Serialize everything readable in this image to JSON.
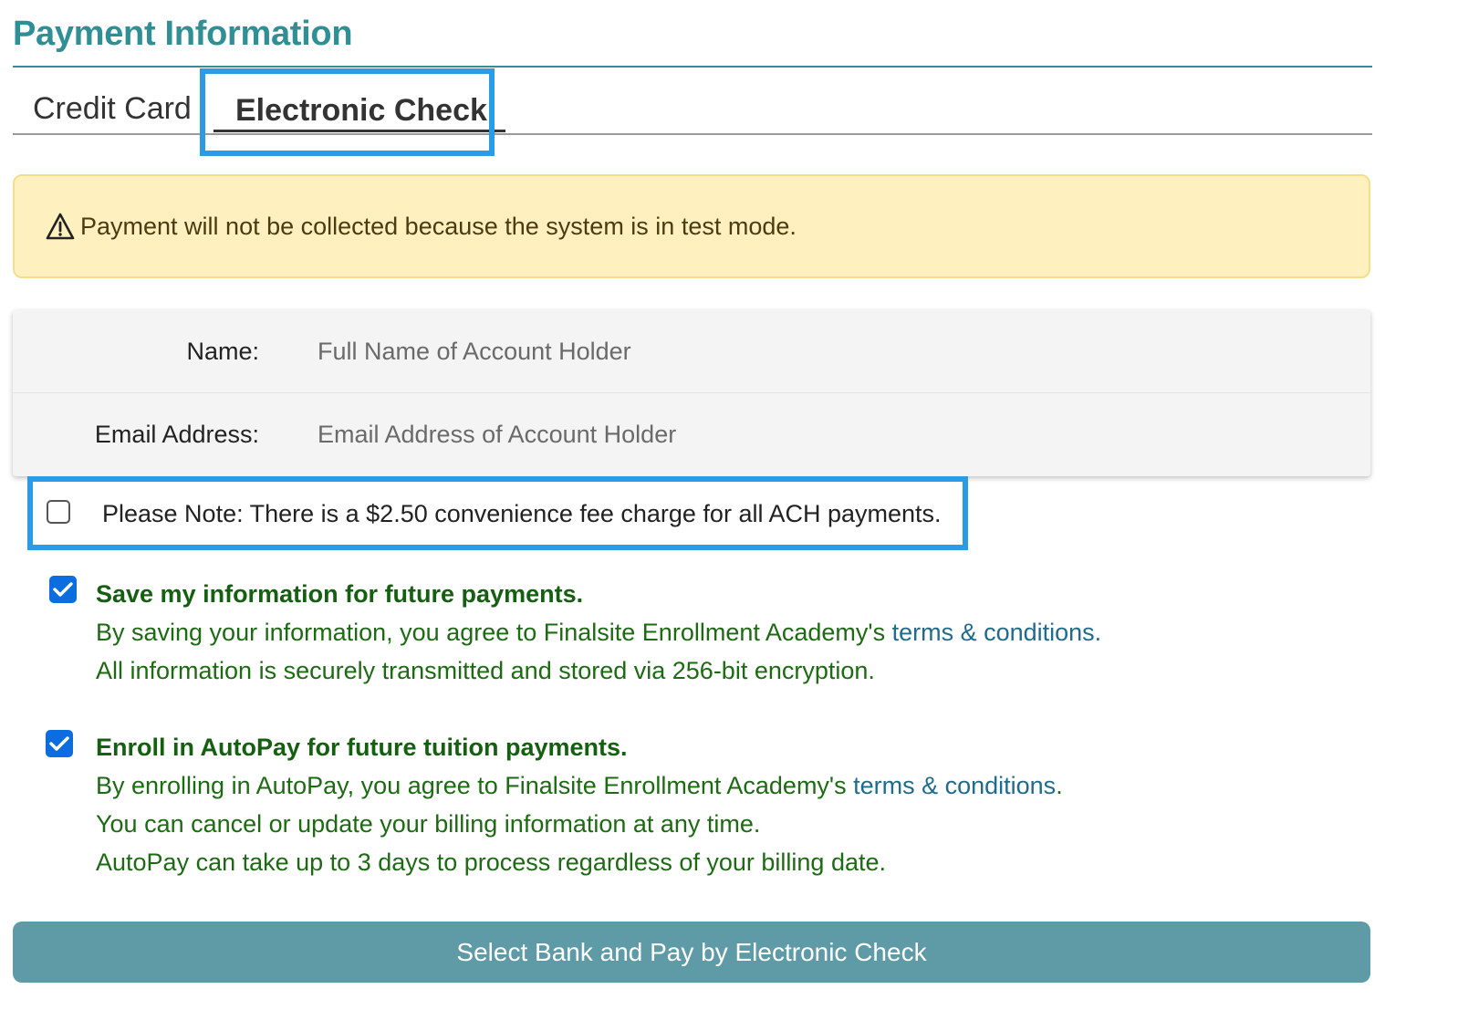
{
  "header": {
    "title": "Payment Information"
  },
  "tabs": {
    "credit_card": "Credit Card",
    "electronic_check": "Electronic Check"
  },
  "alert": {
    "text": "Payment will not be collected because the system is in test mode.",
    "icon": "warning-triangle-icon"
  },
  "form": {
    "name_label": "Name:",
    "name_placeholder": "Full Name of Account Holder",
    "email_label": "Email Address:",
    "email_placeholder": "Email Address of Account Holder"
  },
  "fee_note": {
    "text": "Please Note: There is a $2.50 convenience fee charge for all ACH payments.",
    "checked": false
  },
  "save_info": {
    "checked": true,
    "title": "Save my information for future payments.",
    "line1_prefix": "By saving your information, you agree to Finalsite Enrollment Academy's ",
    "line1_link": "terms & conditions.",
    "line2": "All information is securely transmitted and stored via 256-bit encryption."
  },
  "autopay": {
    "checked": true,
    "title": "Enroll in AutoPay for future tuition payments.",
    "line1_prefix": "By enrolling in AutoPay, you agree to Finalsite Enrollment Academy's ",
    "line1_link": "terms & conditions",
    "line1_suffix": ".",
    "line2": "You can cancel or update your billing information at any time.",
    "line3": "AutoPay can take up to 3 days to process regardless of your billing date."
  },
  "submit": {
    "label": "Select Bank and Pay by Electronic Check"
  },
  "colors": {
    "accent": "#2f8f95",
    "highlight": "#2b9be6",
    "alert_bg": "#fff1bf",
    "option_text": "#1c6b12",
    "link": "#1f6b8e",
    "button": "#5f9ba6",
    "checkbox": "#0b6de0"
  }
}
